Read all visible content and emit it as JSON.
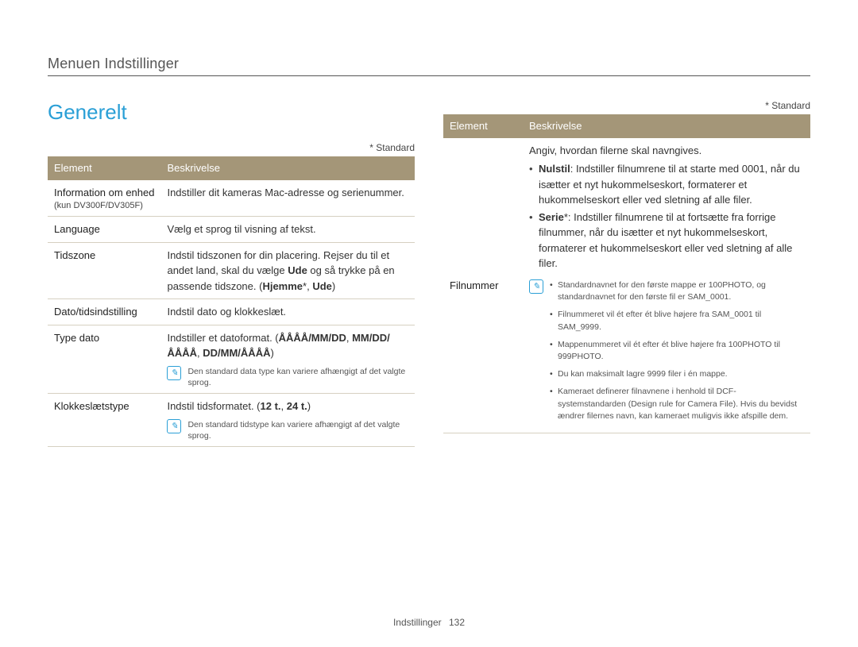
{
  "page": {
    "breadcrumb": "Menuen Indstillinger",
    "section_title": "Generelt",
    "standard_note": "* Standard",
    "footer_label": "Indstillinger",
    "footer_page": "132",
    "note_icon_glyph": "✎"
  },
  "left_table": {
    "header_element": "Element",
    "header_description": "Beskrivelse",
    "rows": {
      "info": {
        "label": "Information om enhed",
        "sublabel": "(kun DV300F/DV305F)",
        "desc": "Indstiller dit kameras Mac-adresse og serienummer."
      },
      "language": {
        "label": "Language",
        "desc": "Vælg et sprog til visning af tekst."
      },
      "timezone": {
        "label": "Tidszone",
        "desc_pre": "Indstil tidszonen for din placering. Rejser du til et andet land, skal du vælge ",
        "desc_bold1": "Ude",
        "desc_mid": " og så trykke på en passende tidszone. (",
        "desc_bold2": "Hjemme",
        "desc_star": "*, ",
        "desc_bold3": "Ude",
        "desc_end": ")"
      },
      "datetime": {
        "label": "Dato/tidsindstilling",
        "desc": "Indstil dato og klokkeslæt."
      },
      "datetype": {
        "label": "Type dato",
        "desc_pre": "Indstiller et datoformat. (",
        "desc_bold": "ÅÅÅÅ/MM/DD",
        "desc_sep1": ", ",
        "desc_bold2": "MM/DD/ÅÅÅÅ",
        "desc_sep2": ", ",
        "desc_bold3": "DD/MM/ÅÅÅÅ",
        "desc_end": ")",
        "note": "Den standard data type kan variere afhængigt af det valgte sprog."
      },
      "clocktype": {
        "label": "Klokkeslætstype",
        "desc_pre": "Indstil tidsformatet. (",
        "desc_bold1": "12 t.",
        "desc_sep": ", ",
        "desc_bold2": "24 t.",
        "desc_end": ")",
        "note": "Den standard tidstype kan variere afhængigt af det valgte sprog."
      }
    }
  },
  "right_table": {
    "header_element": "Element",
    "header_description": "Beskrivelse",
    "row": {
      "label": "Filnummer",
      "intro": "Angiv, hvordan filerne skal navngives.",
      "bullets": {
        "reset_label": "Nulstil",
        "reset_text": ": Indstiller filnumrene til at starte med 0001, når du isætter et nyt hukommelseskort, formaterer et hukommelseskort eller ved sletning af alle filer.",
        "series_label": "Serie",
        "series_star": "*",
        "series_text": ": Indstiller filnumrene til at fortsætte fra forrige filnummer, når du isætter et nyt hukommelseskort, formaterer et hukommelseskort eller ved sletning af alle filer."
      },
      "notes": [
        "Standardnavnet for den første mappe er 100PHOTO, og standardnavnet for den første fil er SAM_0001.",
        "Filnummeret vil ét efter ét blive højere fra SAM_0001 til SAM_9999.",
        "Mappenummeret vil ét efter ét blive højere fra 100PHOTO til 999PHOTO.",
        "Du kan maksimalt lagre 9999 filer i én mappe.",
        "Kameraet definerer filnavnene i henhold til DCF-systemstandarden (Design rule for Camera File). Hvis du bevidst ændrer filernes navn, kan kameraet muligvis ikke afspille dem."
      ]
    }
  }
}
